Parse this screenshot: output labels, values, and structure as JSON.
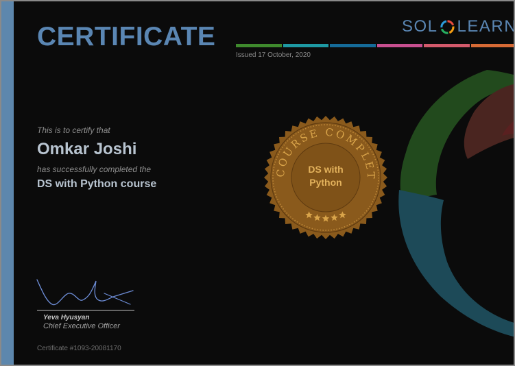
{
  "certificate": {
    "title": "CERTIFICATE",
    "issued": "Issued 17 October, 2020",
    "certify_text": "This is to certify that",
    "recipient_name": "Omkar Joshi",
    "completed_text": "has successfully completed the",
    "course_name": "DS with Python course",
    "certificate_number": "Certificate #1093-20081170"
  },
  "logo": {
    "left_text": "SOL",
    "right_text": "LEARN",
    "icon": "sololearn-ring-icon"
  },
  "seal": {
    "arc_text": "COURSE COMPLETED",
    "line1": "DS with",
    "line2": "Python",
    "stars": 5,
    "icon": "seal-badge-icon"
  },
  "signature": {
    "name": "Yeva Hyusyan",
    "title": "Chief Executive Officer",
    "icon": "handwritten-signature"
  },
  "colors": {
    "brand_blue": "#5a86b3",
    "seal_gold": "#8a5a1c",
    "seal_text": "#e3b25c",
    "bar": [
      "#3f8a2d",
      "#1e9aa4",
      "#156b99",
      "#c74f8f",
      "#d35a6b",
      "#d66a35"
    ],
    "swoosh": [
      "#224a1d",
      "#4a2520",
      "#1d4a58"
    ]
  }
}
